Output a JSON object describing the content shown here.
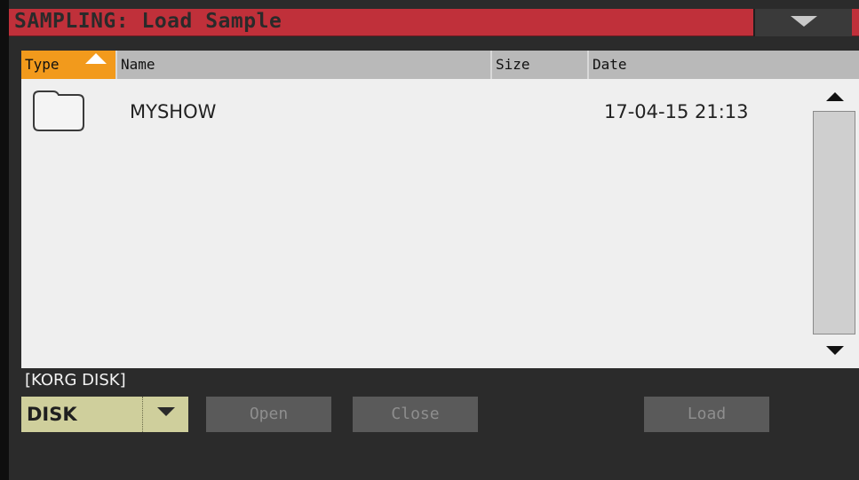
{
  "window": {
    "title": "SAMPLING: Load Sample"
  },
  "columns": {
    "type": "Type",
    "name": "Name",
    "size": "Size",
    "date": "Date"
  },
  "files": [
    {
      "type_icon": "folder-icon",
      "name": "MYSHOW",
      "size": "",
      "date": "17-04-15 21:13"
    }
  ],
  "device_label": "[KORG DISK]",
  "device_select": {
    "value": "DISK"
  },
  "buttons": {
    "open": "Open",
    "close": "Close",
    "load": "Load"
  },
  "colors": {
    "title_bar": "#c0303a",
    "sort_column": "#f29a1c",
    "select_bg": "#cfcf9c"
  }
}
